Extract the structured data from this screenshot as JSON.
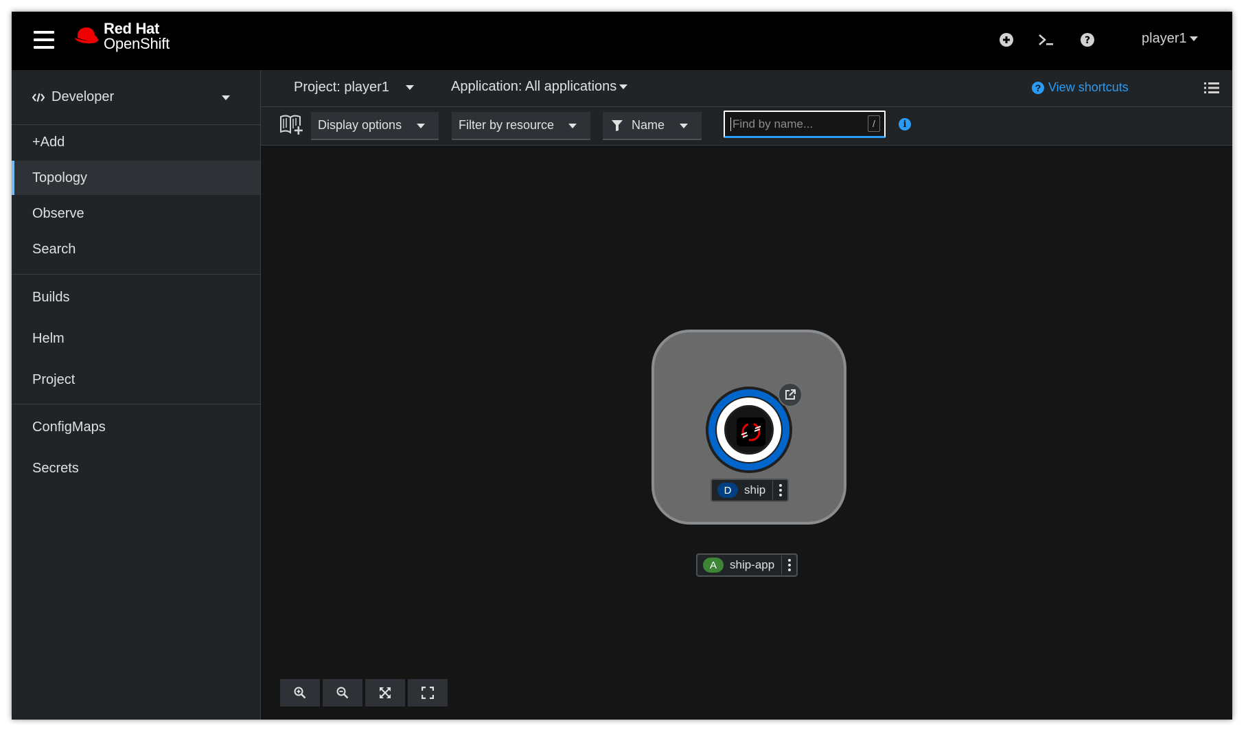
{
  "masthead": {
    "brand_line1": "Red Hat",
    "brand_line2": "OpenShift",
    "user_label": "player1",
    "icons": [
      "hamburger-icon",
      "redhat-logo-icon",
      "add-plus-circle-icon",
      "terminal-icon",
      "help-icon"
    ]
  },
  "sidebar": {
    "perspective_label": "Developer",
    "items": [
      {
        "label": "+Add",
        "active": false
      },
      {
        "label": "Topology",
        "active": true
      },
      {
        "label": "Observe",
        "active": false
      },
      {
        "label": "Search",
        "active": false
      },
      {
        "label": "Builds",
        "active": false
      },
      {
        "label": "Helm",
        "active": false
      },
      {
        "label": "Project",
        "active": false
      },
      {
        "label": "ConfigMaps",
        "active": false
      },
      {
        "label": "Secrets",
        "active": false
      }
    ]
  },
  "header": {
    "project_label": "Project: player1",
    "application_label": "Application: All applications",
    "view_shortcuts_label": "View shortcuts"
  },
  "toolbar": {
    "display_options_label": "Display options",
    "filter_by_resource_label": "Filter by resource",
    "name_filter_label": "Name",
    "search_placeholder": "Find by name...",
    "search_value": "",
    "slash_hint": "/"
  },
  "topology": {
    "node": {
      "badge": "D",
      "name": "ship",
      "badge_color": "#004080"
    },
    "application": {
      "badge": "A",
      "name": "ship-app",
      "badge_color": "#3e8635"
    }
  },
  "colors": {
    "accent_blue": "#2b9af3",
    "active_nav_border": "#73bcf7",
    "redhat_red": "#ee0000"
  }
}
